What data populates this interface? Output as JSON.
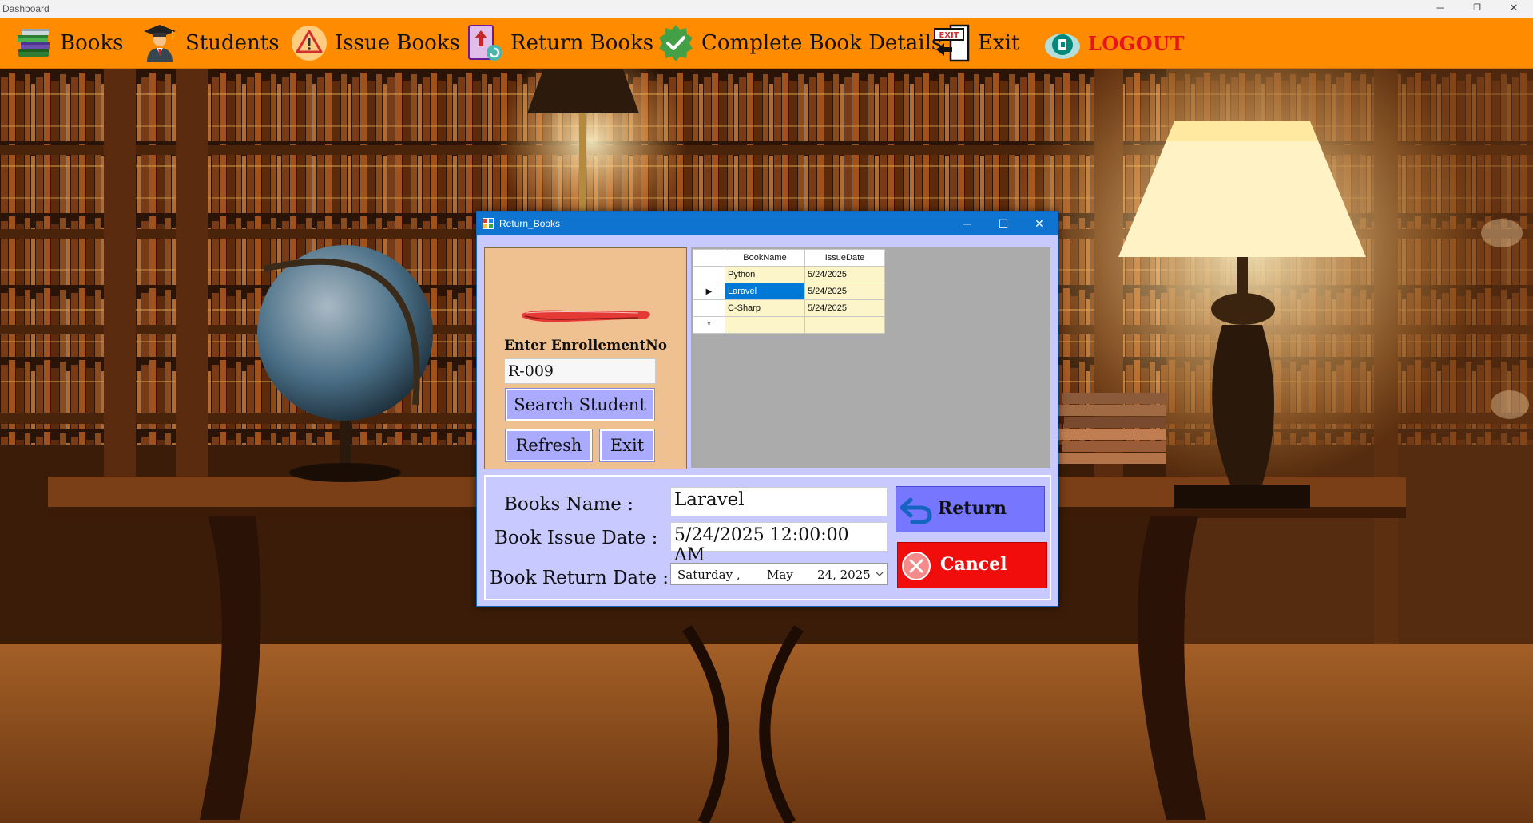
{
  "window": {
    "title": "Dashboard",
    "minimize": "─",
    "maximize": "❐",
    "close": "✕"
  },
  "menu": [
    {
      "label": "Books",
      "icon": "books-stack-icon"
    },
    {
      "label": "Students",
      "icon": "graduate-student-icon"
    },
    {
      "label": "Issue Books",
      "icon": "warning-icon"
    },
    {
      "label": "Return Books",
      "icon": "return-book-icon"
    },
    {
      "label": "Complete Book Details",
      "icon": "check-badge-icon"
    },
    {
      "label": "Exit",
      "icon": "exit-door-icon"
    },
    {
      "label": "LOGOUT",
      "icon": "logout-globe-icon"
    }
  ],
  "dialog": {
    "title": "Return_Books",
    "minimize": "─",
    "maximize": "☐",
    "close": "✕",
    "enrollment_label": "Enter EnrollementNo",
    "enrollment_value": "R-009",
    "search_button": "Search Student",
    "refresh_button": "Refresh",
    "exit_button": "Exit",
    "grid": {
      "columns": [
        "BookName",
        "IssueDate"
      ],
      "rows": [
        {
          "book": "Python",
          "date": "5/24/2025",
          "indicator": ""
        },
        {
          "book": "Laravel",
          "date": "5/24/2025",
          "indicator": "▶"
        },
        {
          "book": "C-Sharp",
          "date": "5/24/2025",
          "indicator": ""
        }
      ],
      "new_row_marker": "*"
    },
    "book_name_label": "Books Name :",
    "book_name_value": "Laravel",
    "issue_date_label": "Book Issue Date :",
    "issue_date_value": "5/24/2025 12:00:00 AM",
    "return_date_label": "Book Return Date :",
    "return_date": {
      "weekday": "Saturday ,",
      "month": "May",
      "day_year": "24, 2025"
    },
    "return_button": "Return",
    "cancel_button": "Cancel"
  }
}
